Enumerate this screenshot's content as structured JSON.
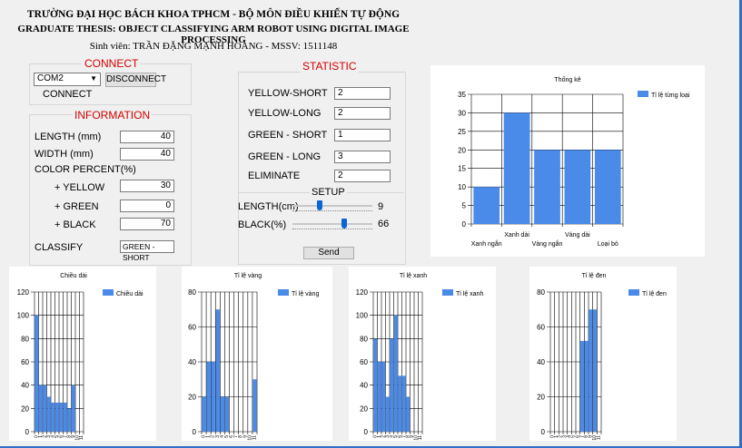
{
  "header": {
    "university": "TRƯỜNG ĐẠI HỌC BÁCH KHOA TPHCM - BỘ MÔN ĐIỀU KHIỂN TỰ ĐỘNG",
    "thesis": "GRADUATE THESIS: OBJECT CLASSIFYING ARM ROBOT  USING DIGITAL IMAGE PROCESSING",
    "student": "Sinh viên: TRẦN ĐẶNG MẠNH HOÀNG   -   MSSV: 1511148"
  },
  "connect": {
    "title": "CONNECT",
    "port": "COM2",
    "disconnect_label": "DISCONNECT",
    "status": "CONNECT"
  },
  "information": {
    "title": "INFORMATION",
    "length_label": "LENGTH (mm)",
    "length_value": "40",
    "width_label": "WIDTH (mm)",
    "width_value": "40",
    "color_label": "COLOR PERCENT(%)",
    "yellow_label": "+ YELLOW",
    "yellow_value": "30",
    "green_label": "+ GREEN",
    "green_value": "0",
    "black_label": "+ BLACK",
    "black_value": "70",
    "classify_label": "CLASSIFY",
    "classify_value": "GREEN - SHORT"
  },
  "statistic": {
    "title": "STATISTIC",
    "rows": [
      {
        "label": "YELLOW-SHORT",
        "value": "2"
      },
      {
        "label": "YELLOW-LONG",
        "value": "2"
      },
      {
        "label": "GREEN - SHORT",
        "value": "1"
      },
      {
        "label": "GREEN - LONG",
        "value": "3"
      },
      {
        "label": "ELIMINATE",
        "value": "2"
      }
    ]
  },
  "setup": {
    "title": "SETUP",
    "length_label": "LENGTH(cm)",
    "length_value": "9",
    "length_level": 0.33,
    "black_label": "BLACK(%)",
    "black_value": "66",
    "black_level": 0.66,
    "send_label": "Send"
  },
  "colors": {
    "bar": "#4a8ae8",
    "accent": "#d40000",
    "edge": "#2f6fc8"
  },
  "chart_data": [
    {
      "type": "bar",
      "title": "Thống kê",
      "categories": [
        "Xanh ngắn",
        "Xanh dài",
        "Vàng ngắn",
        "Vàng dài",
        "Loại bỏ"
      ],
      "series": [
        {
          "name": "Tỉ lệ từng loại",
          "values": [
            10,
            30,
            20,
            20,
            20
          ]
        }
      ],
      "ylim": [
        0,
        35
      ],
      "yticks": [
        0,
        5,
        10,
        15,
        20,
        25,
        30,
        35
      ],
      "grid": true,
      "legend": "top-right"
    },
    {
      "type": "bar",
      "title": "Chiều dài",
      "categories": [
        "0",
        "1",
        "2",
        "3",
        "4",
        "5",
        "6",
        "7",
        "8",
        "9",
        "10",
        "11"
      ],
      "series": [
        {
          "name": "Chiều dài",
          "values": [
            100,
            40,
            40,
            30,
            25,
            25,
            25,
            25,
            20,
            40,
            0,
            0
          ]
        }
      ],
      "ylim": [
        0,
        120
      ],
      "yticks": [
        0,
        20,
        40,
        60,
        80,
        100,
        120
      ],
      "grid": true,
      "legend": "top-right"
    },
    {
      "type": "bar",
      "title": "Tỉ lệ vàng",
      "categories": [
        "0",
        "1",
        "2",
        "3",
        "4",
        "5",
        "6",
        "7",
        "8",
        "9",
        "10",
        "11"
      ],
      "series": [
        {
          "name": "Tỉ lệ vàng",
          "values": [
            20,
            40,
            40,
            70,
            20,
            20,
            0,
            0,
            0,
            0,
            0,
            30
          ]
        }
      ],
      "ylim": [
        0,
        80
      ],
      "yticks": [
        0,
        20,
        40,
        60,
        80
      ],
      "grid": true,
      "legend": "top-right"
    },
    {
      "type": "bar",
      "title": "Tỉ lệ xanh",
      "categories": [
        "0",
        "1",
        "2",
        "3",
        "4",
        "5",
        "6",
        "7",
        "8",
        "9",
        "10",
        "11"
      ],
      "series": [
        {
          "name": "Tỉ lệ xanh",
          "values": [
            80,
            60,
            60,
            30,
            80,
            100,
            48,
            48,
            30,
            0,
            0,
            0
          ]
        }
      ],
      "ylim": [
        0,
        120
      ],
      "yticks": [
        0,
        20,
        40,
        60,
        80,
        100,
        120
      ],
      "grid": true,
      "legend": "top-right"
    },
    {
      "type": "bar",
      "title": "Tỉ lệ đen",
      "categories": [
        "0",
        "1",
        "2",
        "3",
        "4",
        "5",
        "6",
        "7",
        "8",
        "9",
        "10",
        "11"
      ],
      "series": [
        {
          "name": "Tỉ lệ đen",
          "values": [
            0,
            0,
            0,
            0,
            0,
            0,
            0,
            52,
            52,
            70,
            70,
            0
          ]
        }
      ],
      "ylim": [
        0,
        80
      ],
      "yticks": [
        0,
        20,
        40,
        60,
        80
      ],
      "grid": true,
      "legend": "top-right"
    }
  ]
}
